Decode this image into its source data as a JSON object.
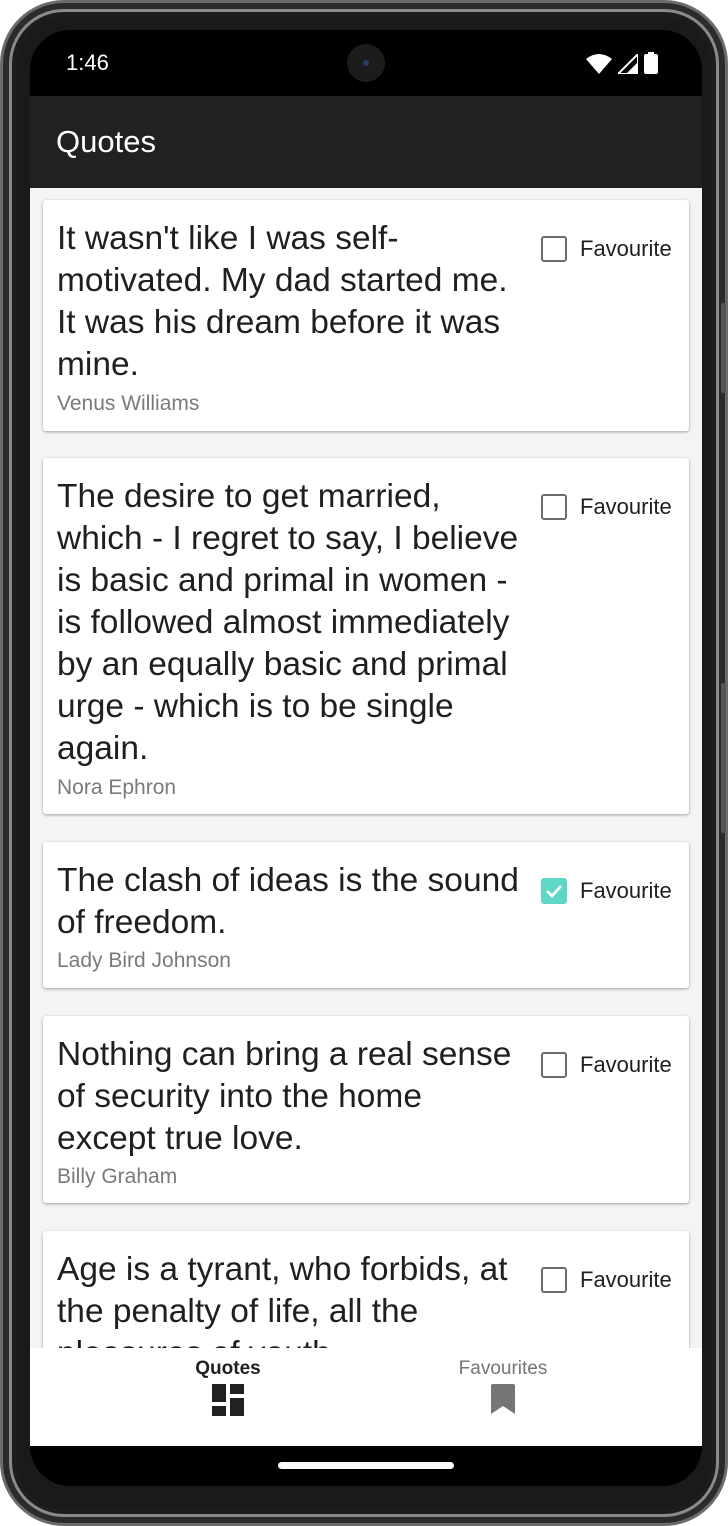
{
  "status_bar": {
    "time": "1:46",
    "icons": [
      "wifi-icon",
      "signal-icon",
      "battery-icon"
    ]
  },
  "app_bar": {
    "title": "Quotes"
  },
  "quotes": [
    {
      "text": "It wasn't like I was self-motivated. My dad started me. It was his dream before it was mine.",
      "author": "Venus Williams",
      "favourite_label": "Favourite",
      "favourite": false
    },
    {
      "text": "The desire to get married, which - I regret to say, I believe is basic and primal in women - is followed almost immediately by an equally basic and primal urge - which is to be single again.",
      "author": "Nora Ephron",
      "favourite_label": "Favourite",
      "favourite": false
    },
    {
      "text": "The clash of ideas is the sound of freedom.",
      "author": "Lady Bird Johnson",
      "favourite_label": "Favourite",
      "favourite": true
    },
    {
      "text": "Nothing can bring a real sense of security into the home except true love.",
      "author": "Billy Graham",
      "favourite_label": "Favourite",
      "favourite": false
    },
    {
      "text": "Age is a tyrant, who forbids, at the penalty of life, all the pleasures of youth.",
      "author": "",
      "favourite_label": "Favourite",
      "favourite": false
    }
  ],
  "bottom_nav": {
    "items": [
      {
        "label": "Quotes",
        "icon": "dashboard-icon",
        "selected": true
      },
      {
        "label": "Favourites",
        "icon": "bookmark-icon",
        "selected": false
      }
    ]
  },
  "colors": {
    "app_bar": "#212121",
    "accent_checkbox": "#5fd6c6",
    "nav_selected": "#212121",
    "nav_unselected": "#757575",
    "author_text": "#7a7a7a"
  }
}
